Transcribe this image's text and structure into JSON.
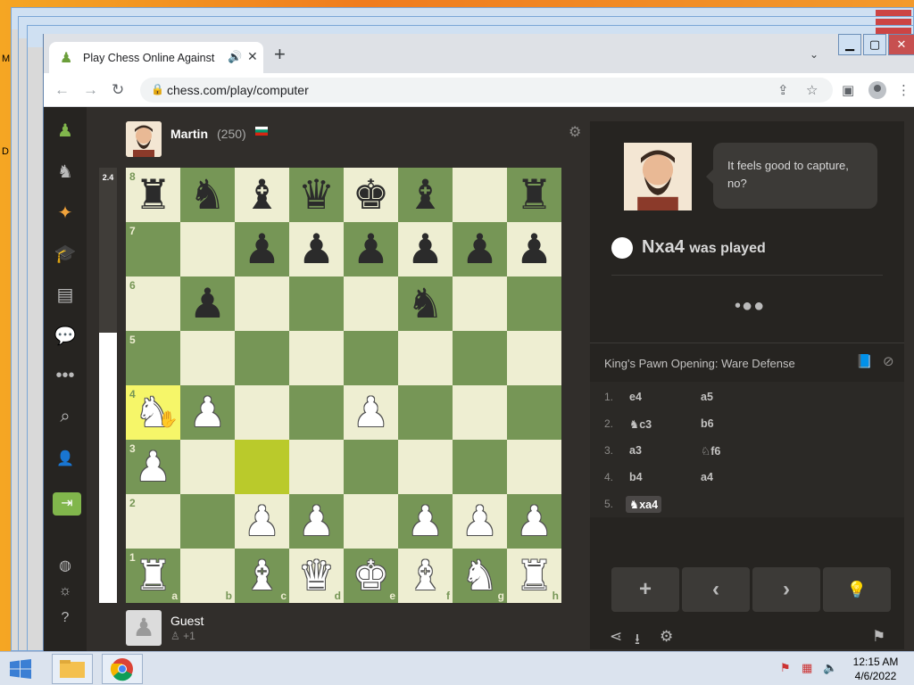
{
  "browser": {
    "tab_title": "Play Chess Online Against the Computer",
    "url": "chess.com/play/computer",
    "new_tab_label": "+",
    "back_icon": "arrow-left-icon",
    "forward_icon": "arrow-right-icon",
    "reload_icon": "reload-icon"
  },
  "top_player": {
    "name": "Martin",
    "rating": "(250)"
  },
  "eval": {
    "score": "2.4",
    "white_fraction": 0.62
  },
  "board": {
    "ranks": [
      "8",
      "7",
      "6",
      "5",
      "4",
      "3",
      "2",
      "1"
    ],
    "files": [
      "a",
      "b",
      "c",
      "d",
      "e",
      "f",
      "g",
      "h"
    ],
    "position": [
      [
        "br",
        "bn",
        "bb",
        "bq",
        "bk",
        "bb",
        "",
        "br"
      ],
      [
        "",
        "",
        "bp",
        "bp",
        "bp",
        "bp",
        "bp",
        "bp"
      ],
      [
        "",
        "bp",
        "",
        "",
        "",
        "bn",
        "",
        ""
      ],
      [
        "",
        "",
        "",
        "",
        "",
        "",
        "",
        ""
      ],
      [
        "wn",
        "wp",
        "",
        "",
        "wp",
        "",
        "",
        ""
      ],
      [
        "wp",
        "",
        "",
        "",
        "",
        "",
        "",
        ""
      ],
      [
        "",
        "",
        "wp",
        "wp",
        "",
        "wp",
        "wp",
        "wp"
      ],
      [
        "wr",
        "",
        "wb",
        "wq",
        "wk",
        "wb",
        "wn",
        "wr"
      ]
    ],
    "highlights": [
      "a4",
      "c3"
    ]
  },
  "bottom_player": {
    "name": "Guest",
    "captured": "+1"
  },
  "coach": {
    "message": "It feels good to capture, no?",
    "move": "Nxa4",
    "move_suffix": "was played",
    "thinking": "•●●"
  },
  "opening": {
    "name": "King's Pawn Opening: Ware Defense"
  },
  "moves": [
    {
      "num": "1.",
      "white": "e4",
      "black": "a5"
    },
    {
      "num": "2.",
      "white": "♞c3",
      "black": "b6"
    },
    {
      "num": "3.",
      "white": "a3",
      "black": "♘f6"
    },
    {
      "num": "4.",
      "white": "b4",
      "black": "a4"
    },
    {
      "num": "5.",
      "white": "♞xa4",
      "black": ""
    }
  ],
  "controls": {
    "new_label": "+",
    "prev_label": "‹",
    "next_label": "›",
    "hint_label": "💡"
  },
  "taskbar": {
    "time": "12:15 AM",
    "date": "4/6/2022"
  },
  "colors": {
    "board_light": "#eeeed2",
    "board_dark": "#769656",
    "highlight": "#f6f669",
    "accent": "#81b64c"
  }
}
